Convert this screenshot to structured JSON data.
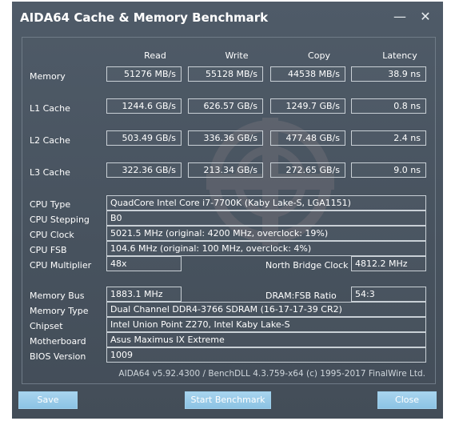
{
  "window": {
    "title": "AIDA64 Cache & Memory Benchmark",
    "minimize_glyph": "—",
    "close_glyph": "✕"
  },
  "columns": [
    "Read",
    "Write",
    "Copy",
    "Latency"
  ],
  "bench_rows": [
    {
      "label": "Memory",
      "values": [
        "51276 MB/s",
        "55128 MB/s",
        "44538 MB/s",
        "38.9 ns"
      ]
    },
    {
      "label": "L1 Cache",
      "values": [
        "1244.6 GB/s",
        "626.57 GB/s",
        "1249.7 GB/s",
        "0.8 ns"
      ]
    },
    {
      "label": "L2 Cache",
      "values": [
        "503.49 GB/s",
        "336.36 GB/s",
        "477.48 GB/s",
        "2.4 ns"
      ]
    },
    {
      "label": "L3 Cache",
      "values": [
        "322.36 GB/s",
        "213.34 GB/s",
        "272.65 GB/s",
        "9.0 ns"
      ]
    }
  ],
  "cpu": {
    "type_label": "CPU Type",
    "type_value": "QuadCore Intel Core i7-7700K  (Kaby Lake-S, LGA1151)",
    "stepping_label": "CPU Stepping",
    "stepping_value": "B0",
    "clock_label": "CPU Clock",
    "clock_value": "5021.5 MHz  (original: 4200 MHz, overclock: 19%)",
    "fsb_label": "CPU FSB",
    "fsb_value": "104.6 MHz  (original: 100 MHz, overclock: 4%)",
    "multiplier_label": "CPU Multiplier",
    "multiplier_value": "48x",
    "nb_clock_label": "North Bridge Clock",
    "nb_clock_value": "4812.2 MHz"
  },
  "memory": {
    "bus_label": "Memory Bus",
    "bus_value": "1883.1 MHz",
    "ratio_label": "DRAM:FSB Ratio",
    "ratio_value": "54:3",
    "type_label": "Memory Type",
    "type_value": "Dual Channel DDR4-3766 SDRAM  (16-17-17-39 CR2)",
    "chipset_label": "Chipset",
    "chipset_value": "Intel Union Point Z270, Intel Kaby Lake-S",
    "motherboard_label": "Motherboard",
    "motherboard_value": "Asus Maximus IX Extreme",
    "bios_label": "BIOS Version",
    "bios_value": "1009"
  },
  "footer": "AIDA64 v5.92.4300 / BenchDLL 4.3.759-x64  (c) 1995-2017 FinalWire Ltd.",
  "buttons": {
    "save": "Save",
    "start": "Start Benchmark",
    "close": "Close"
  },
  "colors": {
    "window_bg": "#4b5662",
    "button_bg": "#9acbe9",
    "text": "#ffffff"
  },
  "watermark_text": "RACING GEAR.COM"
}
